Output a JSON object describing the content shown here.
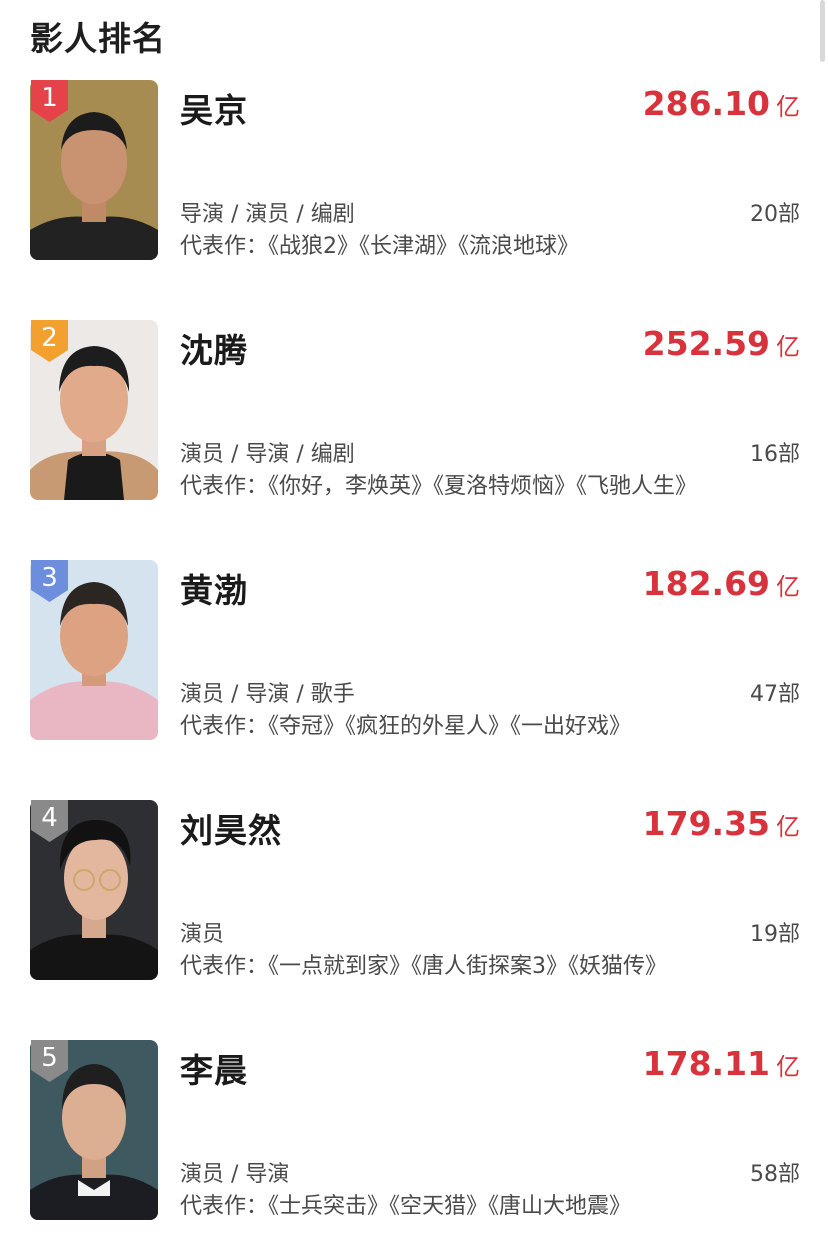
{
  "page_title": "影人排名",
  "colors": {
    "box_office": "#d8323c",
    "badge_gold_1": "#e5424a",
    "badge_2": "#f2a02e",
    "badge_3": "#6c8edc",
    "badge_other": "#8a8a8a"
  },
  "unit": "亿",
  "rankings": [
    {
      "rank": "1",
      "name": "吴京",
      "box_office": "286.10",
      "roles": "导演 / 演员 / 编剧",
      "films": "20部",
      "works": "代表作：《战狼2》《长津湖》《流浪地球》"
    },
    {
      "rank": "2",
      "name": "沈腾",
      "box_office": "252.59",
      "roles": "演员 / 导演 / 编剧",
      "films": "16部",
      "works": "代表作：《你好，李焕英》《夏洛特烦恼》《飞驰人生》"
    },
    {
      "rank": "3",
      "name": "黄渤",
      "box_office": "182.69",
      "roles": "演员 / 导演 / 歌手",
      "films": "47部",
      "works": "代表作：《夺冠》《疯狂的外星人》《一出好戏》"
    },
    {
      "rank": "4",
      "name": "刘昊然",
      "box_office": "179.35",
      "roles": "演员",
      "films": "19部",
      "works": "代表作：《一点就到家》《唐人街探案3》《妖猫传》"
    },
    {
      "rank": "5",
      "name": "李晨",
      "box_office": "178.11",
      "roles": "演员 / 导演",
      "films": "58部",
      "works": "代表作：《士兵突击》《空天猎》《唐山大地震》"
    }
  ]
}
